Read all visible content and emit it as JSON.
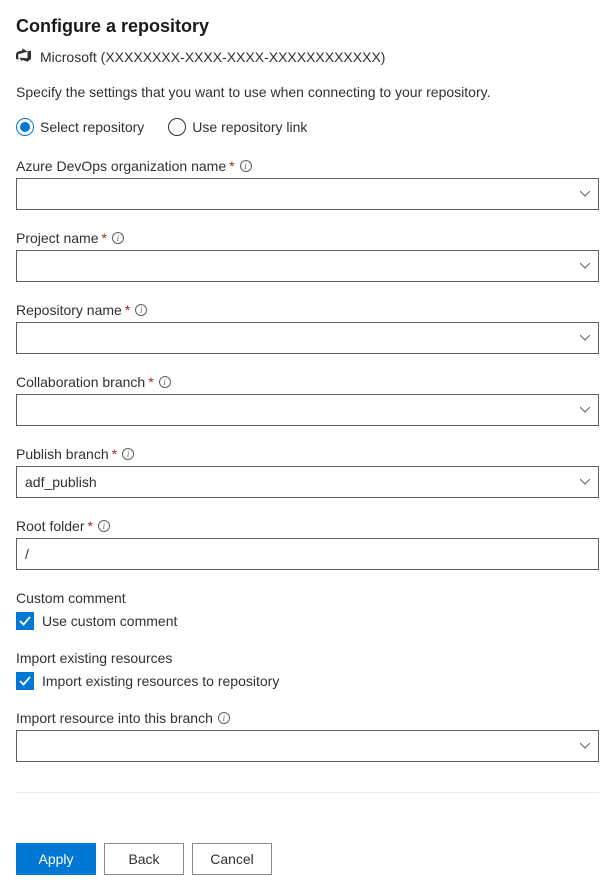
{
  "header": {
    "title": "Configure a repository",
    "org": "Microsoft (XXXXXXXX-XXXX-XXXX-XXXXXXXXXXXX)"
  },
  "description": "Specify the settings that you want to use when connecting to your repository.",
  "radios": {
    "select_repo": "Select repository",
    "use_link": "Use repository link"
  },
  "fields": {
    "org_name": {
      "label": "Azure DevOps organization name",
      "value": ""
    },
    "project_name": {
      "label": "Project name",
      "value": ""
    },
    "repo_name": {
      "label": "Repository name",
      "value": ""
    },
    "collab_branch": {
      "label": "Collaboration branch",
      "value": ""
    },
    "publish_branch": {
      "label": "Publish branch",
      "value": "adf_publish"
    },
    "root_folder": {
      "label": "Root folder",
      "value": "/"
    },
    "import_branch": {
      "label": "Import resource into this branch",
      "value": ""
    }
  },
  "sections": {
    "custom_comment": {
      "header": "Custom comment",
      "checkbox_label": "Use custom comment"
    },
    "import_existing": {
      "header": "Import existing resources",
      "checkbox_label": "Import existing resources to repository"
    }
  },
  "buttons": {
    "apply": "Apply",
    "back": "Back",
    "cancel": "Cancel"
  }
}
